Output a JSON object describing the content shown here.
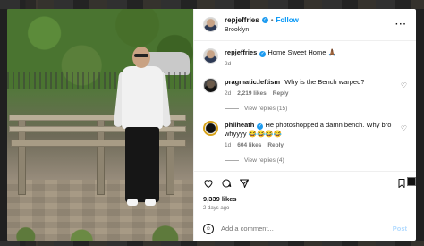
{
  "post": {
    "author": "repjeffries",
    "follow_separator": "•",
    "follow_label": "Follow",
    "location": "Brooklyn",
    "more_label": "···"
  },
  "comments": [
    {
      "username": "repjeffries",
      "verified": true,
      "text": "Home Sweet Home 🙏🏾",
      "time": "2d",
      "likes": "",
      "reply_label": "",
      "view_replies": ""
    },
    {
      "username": "pragmatic.leftism",
      "verified": false,
      "text": "Why is the Bench warped?",
      "time": "2d",
      "likes": "2,219 likes",
      "reply_label": "Reply",
      "view_replies": "View replies (15)"
    },
    {
      "username": "philheath",
      "verified": true,
      "text": "He photoshopped a damn bench. Why bro whyyyy 😂😂😂😂",
      "time": "1d",
      "likes": "604 likes",
      "reply_label": "Reply",
      "view_replies": "View replies (4)"
    }
  ],
  "actions": {
    "like_count": "9,339 likes",
    "date": "2 days ago"
  },
  "add_comment": {
    "placeholder": "Add a comment...",
    "post_label": "Post"
  },
  "icons": [
    "heart-icon",
    "comment-icon",
    "share-icon",
    "bookmark-icon",
    "emoji-icon",
    "more-icon"
  ]
}
